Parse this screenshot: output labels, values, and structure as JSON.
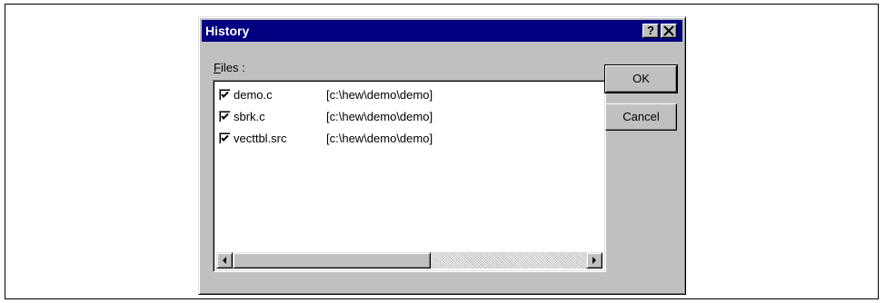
{
  "window": {
    "title": "History",
    "help_button": "?",
    "close_button": "✕"
  },
  "files": {
    "label_accel": "F",
    "label_rest": "iles :",
    "items": [
      {
        "name": "demo.c",
        "path": "[c:\\hew\\demo\\demo]",
        "checked": true
      },
      {
        "name": "sbrk.c",
        "path": "[c:\\hew\\demo\\demo]",
        "checked": true
      },
      {
        "name": "vecttbl.src",
        "path": "[c:\\hew\\demo\\demo]",
        "checked": true
      }
    ]
  },
  "buttons": {
    "ok": "OK",
    "cancel": "Cancel"
  },
  "colors": {
    "titlebar": "#000080",
    "face": "#c0c0c0"
  }
}
